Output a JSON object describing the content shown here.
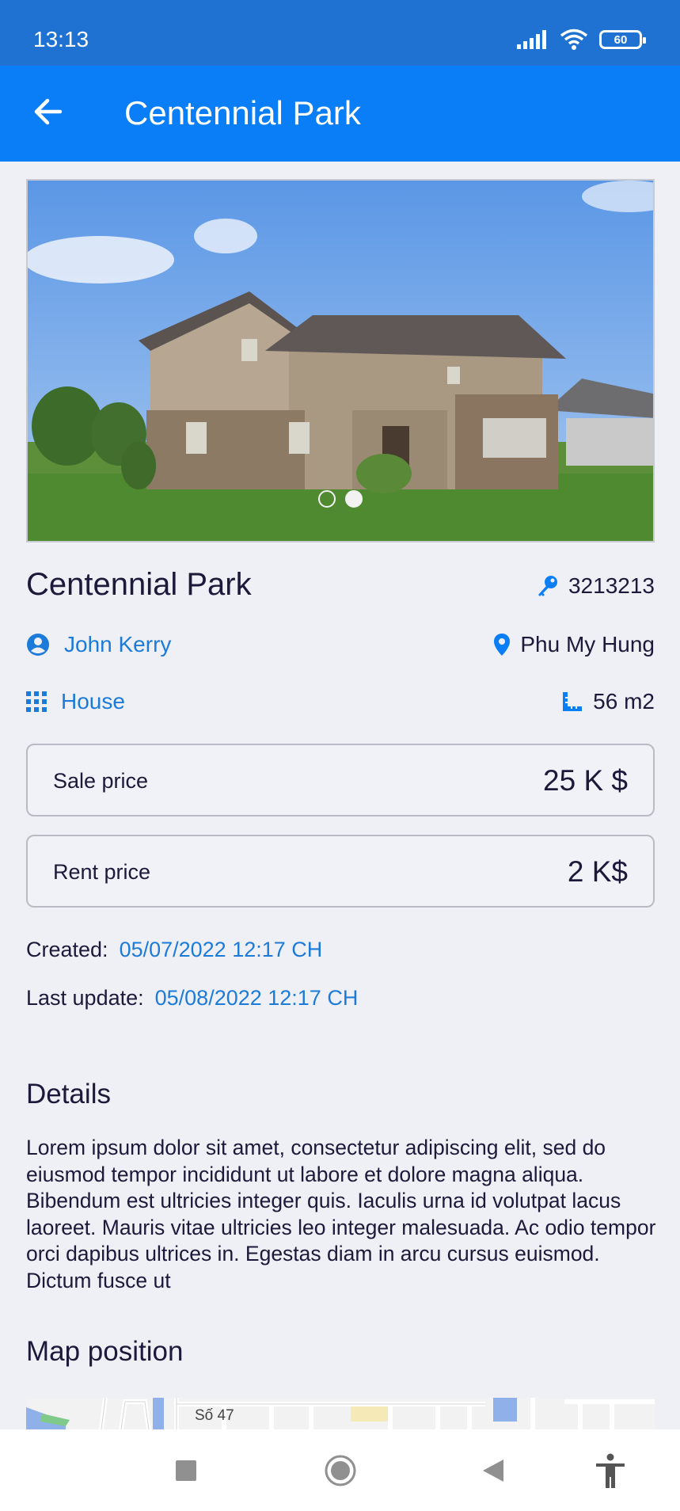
{
  "status": {
    "time": "13:13",
    "battery": "60"
  },
  "app_bar": {
    "title": "Centennial Park"
  },
  "hero": {
    "slide_count": 2,
    "active_slide": 2
  },
  "property": {
    "title": "Centennial Park",
    "code": "3213213",
    "owner": "John Kerry",
    "location": "Phu My Hung",
    "type": "House",
    "area": "56 m2"
  },
  "prices": {
    "sale_label": "Sale price",
    "sale_value": "25 K $",
    "rent_label": "Rent price",
    "rent_value": "2 K$"
  },
  "meta": {
    "created_label": "Created:",
    "created_value": "05/07/2022 12:17 CH",
    "updated_label": "Last update:",
    "updated_value": "05/08/2022 12:17 CH"
  },
  "details": {
    "title": "Details",
    "text": "Lorem ipsum dolor sit amet, consectetur adipiscing elit, sed do eiusmod tempor incididunt ut labore et dolore magna aliqua. Bibendum est ultricies integer quis. Iaculis urna id volutpat lacus laoreet. Mauris vitae ultricies leo integer malesuada. Ac odio tempor orci dapibus ultrices in. Egestas diam in arcu cursus euismod. Dictum fusce ut"
  },
  "map": {
    "title": "Map position",
    "street_label": "Số 47"
  },
  "colors": {
    "accent": "#0a7ef6",
    "status_bar": "#1f72d1",
    "link": "#1c7bd8",
    "background": "#eff0f5"
  }
}
